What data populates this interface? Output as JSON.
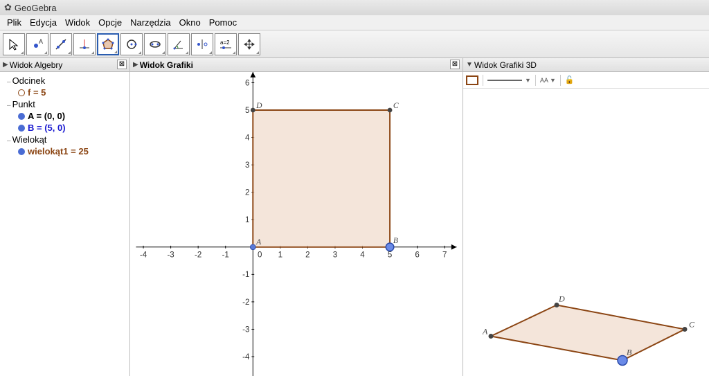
{
  "title": "GeoGebra",
  "menu": [
    "Plik",
    "Edycja",
    "Widok",
    "Opcje",
    "Narzędzia",
    "Okno",
    "Pomoc"
  ],
  "toolbar": {
    "param_label": "a=2"
  },
  "panels": {
    "algebra": {
      "title": "Widok Algebry"
    },
    "graphics": {
      "title": "Widok Grafiki"
    },
    "graphics3d": {
      "title": "Widok Grafiki 3D"
    }
  },
  "tree": {
    "segment_group": "Odcinek",
    "segment_item": "f = 5",
    "point_group": "Punkt",
    "point_a": "A = (0, 0)",
    "point_b": "B = (5, 0)",
    "polygon_group": "Wielokąt",
    "polygon_item": "wielokąt1 = 25"
  },
  "points2d": {
    "A": "A",
    "B": "B",
    "C": "C",
    "D": "D"
  },
  "points3d": {
    "A": "A",
    "B": "B",
    "C": "C",
    "D": "D"
  },
  "toolbar3d": {
    "font": "AA"
  },
  "chart_data": {
    "type": "polygon",
    "title": "Widok Grafiki",
    "xlabel": "",
    "ylabel": "",
    "xlim": [
      -4,
      7
    ],
    "ylim": [
      -4,
      6
    ],
    "xticks": [
      -4,
      -3,
      -2,
      -1,
      0,
      1,
      2,
      3,
      4,
      5,
      6,
      7
    ],
    "yticks": [
      -4,
      -3,
      -2,
      -1,
      1,
      2,
      3,
      4,
      5,
      6
    ],
    "points": {
      "A": [
        0,
        0
      ],
      "B": [
        5,
        0
      ],
      "C": [
        5,
        5
      ],
      "D": [
        0,
        5
      ]
    },
    "polygon": [
      "A",
      "B",
      "C",
      "D"
    ],
    "area": 25,
    "segment_f": 5
  }
}
